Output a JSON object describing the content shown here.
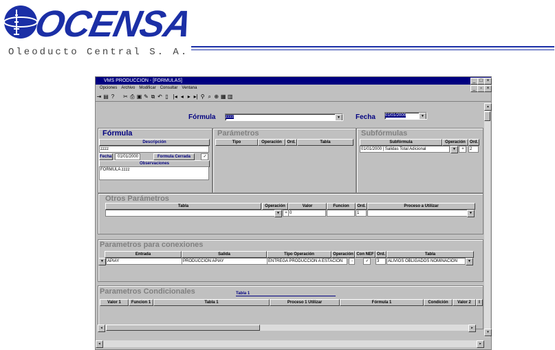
{
  "logo": {
    "brand": "OCENSA",
    "subtitle": "Oleoducto Central S. A."
  },
  "window": {
    "title": "VMS     PRODUCCION - [FORMULAS]",
    "menu": [
      "Opciones",
      "Archivo",
      "Modificar",
      "Consultar",
      "Ventana"
    ],
    "toolbar_icons": [
      "exit-icon",
      "print-icon",
      "help-icon",
      "cut-icon",
      "print2-icon",
      "save-icon",
      "edit-icon",
      "copy-icon",
      "undo-icon",
      "document-icon",
      "first-icon",
      "prev-icon",
      "next-icon",
      "last-icon",
      "filter-icon",
      "find-icon",
      "zoom-icon",
      "report-icon",
      "grid-icon"
    ]
  },
  "header": {
    "formula_label": "Fórmula",
    "formula_value": "zzzz",
    "fecha_label": "Fecha",
    "fecha_value": "01/01/2000"
  },
  "formula_panel": {
    "title": "Fórmula",
    "descripcion_header": "Descripción",
    "descripcion_value": "zzzz",
    "fecha_label": "Fecha",
    "fecha_value": "01/01/2000",
    "cerrada_label": "Formula Cerrada",
    "cerrada_checked": "✓",
    "observaciones_header": "Observaciones",
    "observaciones_value": "FORMULA zzzz"
  },
  "parametros_panel": {
    "title": "Parámetros",
    "columns": [
      "Tipo",
      "Operación",
      "Ord.",
      "Tabla"
    ]
  },
  "subformulas_panel": {
    "title": "Subfórmulas",
    "columns": [
      "Subfórmula",
      "Operación",
      "Ord."
    ],
    "row": {
      "subformula": "01/01/2000 | Salidas Total Adicional",
      "operacion": "+",
      "ord": "2"
    }
  },
  "otros_panel": {
    "title": "Otros Parámetros",
    "columns": [
      "Tabla",
      "Operación",
      "Valor",
      "Funcion",
      "Ord.",
      "Proceso a Utilizar"
    ],
    "row": {
      "operacion": "+",
      "valor": "0",
      "ord": "1"
    }
  },
  "conexiones_panel": {
    "title": "Parametros para conexiones",
    "columns": [
      "Entrada",
      "Salida",
      "Tipo Operación",
      "Operación",
      "Con NEF",
      "Ord.",
      "Tabla"
    ],
    "row": {
      "entrada": "APIAY",
      "salida": "PRODUCCION  APIAY",
      "tipo": "ENTREGA PRODUCCION A ESTACION",
      "operacion": "-",
      "con_nef": "✓",
      "ord": "3",
      "tabla": "ALIVIOS OBLIGADOS NOMINACION"
    }
  },
  "condicionales_panel": {
    "title": "Parametros Condicionales",
    "tab": "Tabla 1",
    "columns": [
      "Valor 1",
      "Funcion 1",
      "Tabla 1",
      "Proceso 1 Utilizar",
      "Fórmula 1",
      "Condición",
      "Valor 2",
      "I"
    ]
  }
}
